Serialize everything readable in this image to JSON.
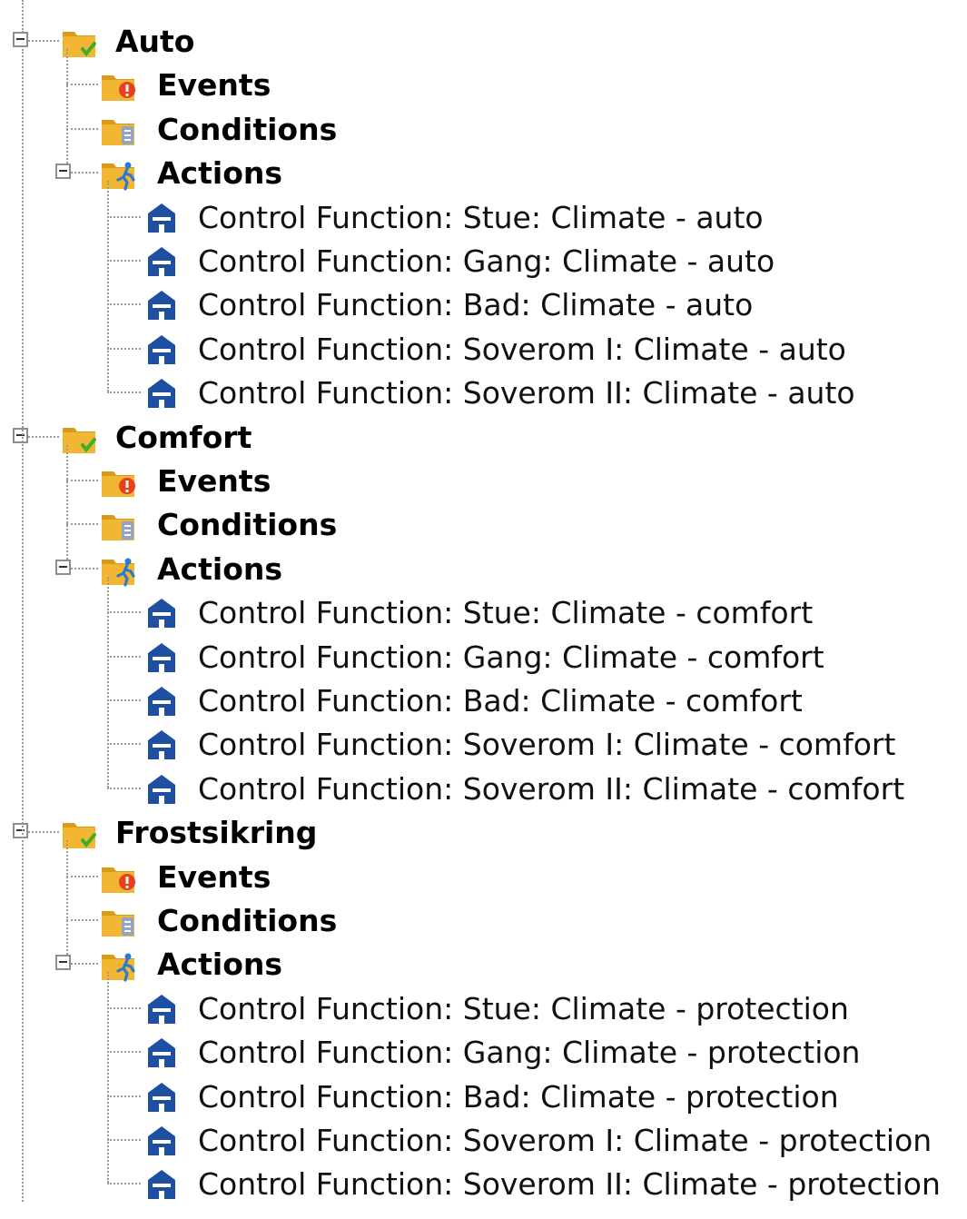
{
  "tree": [
    {
      "label": "Auto",
      "icon": "folder-check-icon",
      "expanded": true,
      "children": [
        {
          "label": "Events",
          "icon": "folder-events-icon"
        },
        {
          "label": "Conditions",
          "icon": "folder-conditions-icon"
        },
        {
          "label": "Actions",
          "icon": "folder-actions-icon",
          "expanded": true,
          "children": [
            {
              "label": "Control Function: Stue: Climate - auto",
              "icon": "house-icon"
            },
            {
              "label": "Control Function: Gang: Climate - auto",
              "icon": "house-icon"
            },
            {
              "label": "Control Function: Bad: Climate - auto",
              "icon": "house-icon"
            },
            {
              "label": "Control Function: Soverom I: Climate - auto",
              "icon": "house-icon"
            },
            {
              "label": "Control Function: Soverom II: Climate - auto",
              "icon": "house-icon"
            }
          ]
        }
      ]
    },
    {
      "label": "Comfort",
      "icon": "folder-check-icon",
      "expanded": true,
      "children": [
        {
          "label": "Events",
          "icon": "folder-events-icon"
        },
        {
          "label": "Conditions",
          "icon": "folder-conditions-icon"
        },
        {
          "label": "Actions",
          "icon": "folder-actions-icon",
          "expanded": true,
          "children": [
            {
              "label": "Control Function: Stue: Climate - comfort",
              "icon": "house-icon"
            },
            {
              "label": "Control Function: Gang: Climate - comfort",
              "icon": "house-icon"
            },
            {
              "label": "Control Function: Bad: Climate - comfort",
              "icon": "house-icon"
            },
            {
              "label": "Control Function: Soverom I: Climate - comfort",
              "icon": "house-icon"
            },
            {
              "label": "Control Function: Soverom II: Climate - comfort",
              "icon": "house-icon"
            }
          ]
        }
      ]
    },
    {
      "label": "Frostsikring",
      "icon": "folder-check-icon",
      "expanded": true,
      "children": [
        {
          "label": "Events",
          "icon": "folder-events-icon"
        },
        {
          "label": "Conditions",
          "icon": "folder-conditions-icon"
        },
        {
          "label": "Actions",
          "icon": "folder-actions-icon",
          "expanded": true,
          "children": [
            {
              "label": "Control Function: Stue: Climate - protection",
              "icon": "house-icon"
            },
            {
              "label": "Control Function: Gang: Climate - protection",
              "icon": "house-icon"
            },
            {
              "label": "Control Function: Bad: Climate - protection",
              "icon": "house-icon"
            },
            {
              "label": "Control Function: Soverom I: Climate - protection",
              "icon": "house-icon"
            },
            {
              "label": "Control Function: Soverom II: Climate - protection",
              "icon": "house-icon"
            }
          ]
        }
      ]
    }
  ],
  "colors": {
    "folder": "#f2b632",
    "folder_dark": "#d99a18",
    "check": "#3fae2a",
    "events_badge": "#e8401c",
    "conditions_badge": "#8fa6c8",
    "actions_figure": "#2a7bd0",
    "house": "#1f4fa3",
    "connector": "#9a9a9a"
  }
}
